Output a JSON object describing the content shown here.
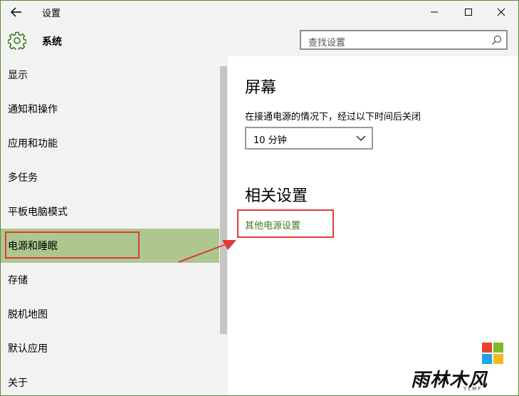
{
  "window": {
    "title": "设置",
    "accent_color": "#adc78f",
    "link_color": "#3c7a1e",
    "highlight_color": "#e03a3a"
  },
  "header": {
    "app_name": "系统",
    "search_placeholder": "查找设置"
  },
  "sidebar": {
    "items": [
      {
        "label": "显示",
        "selected": false
      },
      {
        "label": "通知和操作",
        "selected": false
      },
      {
        "label": "应用和功能",
        "selected": false
      },
      {
        "label": "多任务",
        "selected": false
      },
      {
        "label": "平板电脑模式",
        "selected": false
      },
      {
        "label": "电源和睡眠",
        "selected": true
      },
      {
        "label": "存储",
        "selected": false
      },
      {
        "label": "脱机地图",
        "selected": false
      },
      {
        "label": "默认应用",
        "selected": false
      },
      {
        "label": "关于",
        "selected": false
      }
    ]
  },
  "main": {
    "screen_title": "屏幕",
    "screen_desc": "在接通电源的情况下，经过以下时间后关闭",
    "screen_timeout": "10 分钟",
    "related_title": "相关设置",
    "power_link": "其他电源设置"
  },
  "watermark": {
    "brand": "雨林木风",
    "sub": "YLMF"
  }
}
